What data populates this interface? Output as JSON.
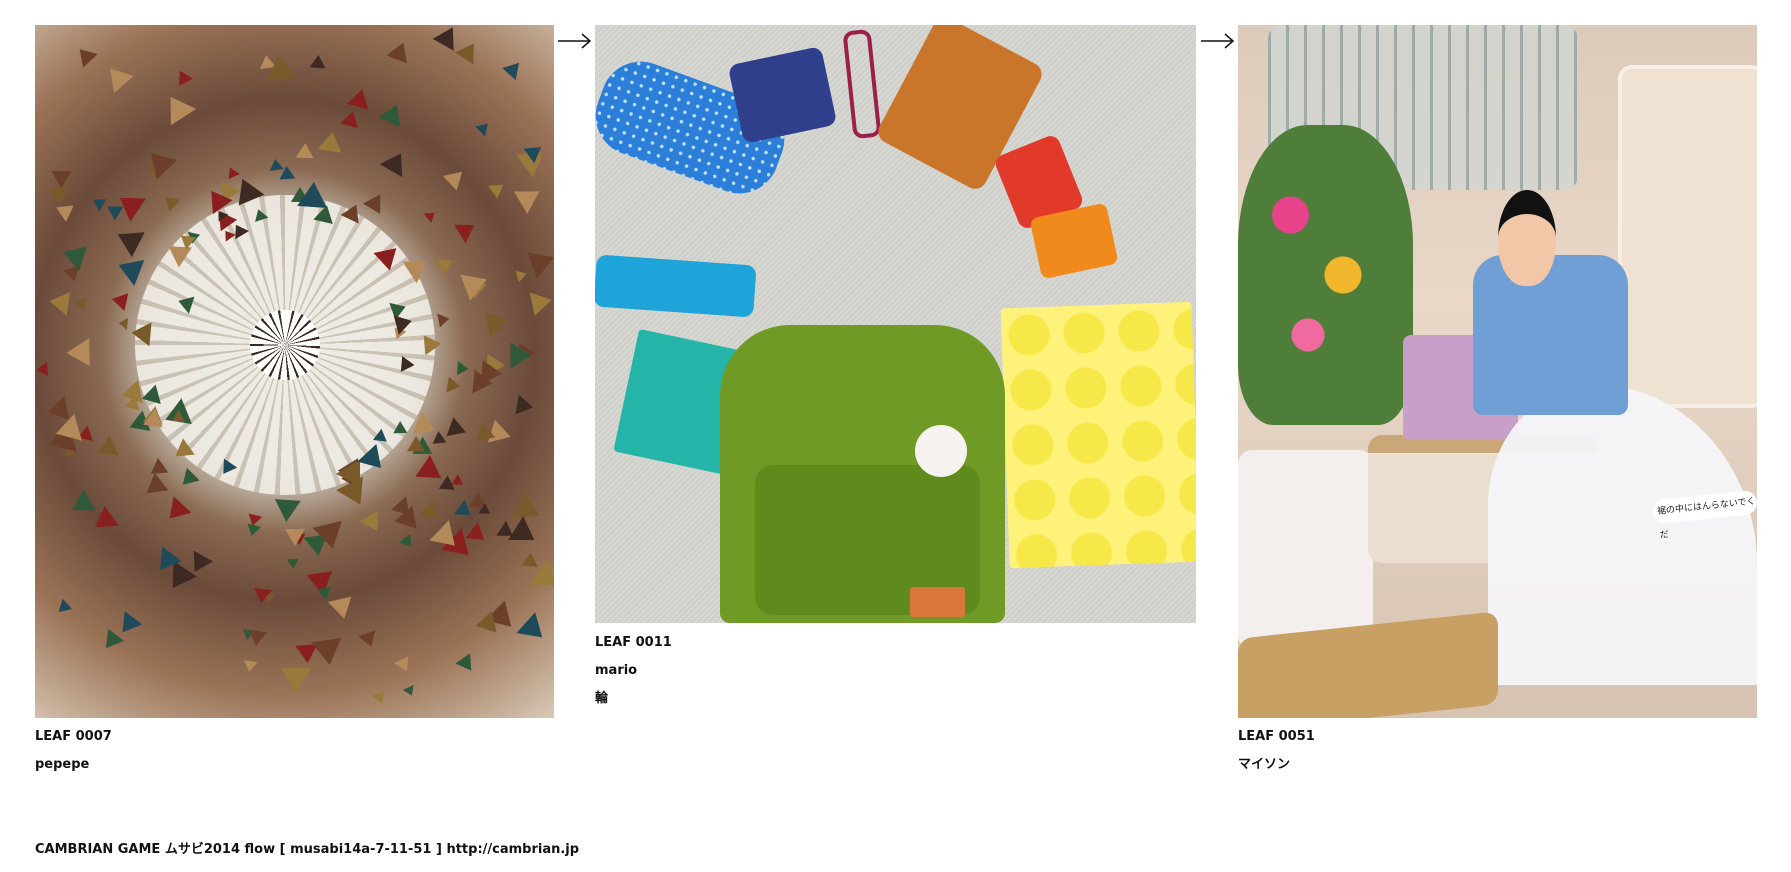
{
  "leaves": [
    {
      "id": "LEAF 0007",
      "author": "pepepe",
      "note": ""
    },
    {
      "id": "LEAF 0011",
      "author": "mario",
      "note": "輪"
    },
    {
      "id": "LEAF 0051",
      "author": "マイソン",
      "note": ""
    }
  ],
  "photo3_sign": "裾の中にはんらないでくだ",
  "footer": "CAMBRIAN GAME  ムサビ2014  flow [ musabi14a-7-11-51 ]    http://cambrian.jp"
}
